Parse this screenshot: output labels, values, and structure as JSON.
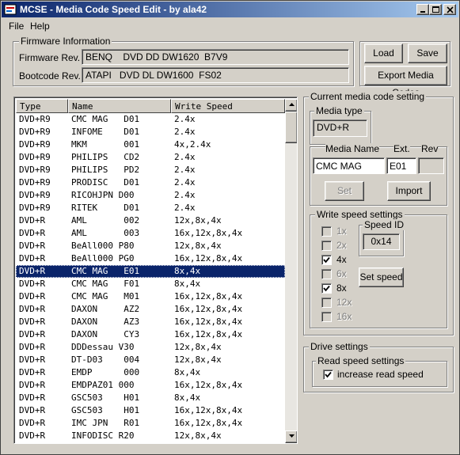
{
  "window": {
    "title": "MCSE - Media Code Speed Edit - by ala42"
  },
  "menu": {
    "file": "File",
    "help": "Help"
  },
  "firmware": {
    "group_label": "Firmware Information",
    "fw_label": "Firmware Rev.",
    "fw_value": "BENQ    DVD DD DW1620  B7V9",
    "boot_label": "Bootcode Rev.",
    "boot_value": "ATAPI   DVD DL DW1600  FS02"
  },
  "buttons": {
    "load": "Load",
    "save": "Save",
    "export": "Export Media Codes",
    "set": "Set",
    "import": "Import",
    "set_speed": "Set speed"
  },
  "list": {
    "headers": [
      "Type",
      "Name",
      "Write Speed"
    ],
    "rows": [
      {
        "type": "DVD+R9",
        "name": "CMC MAG   D01",
        "speed": "2.4x"
      },
      {
        "type": "DVD+R9",
        "name": "INFOME    D01",
        "speed": "2.4x"
      },
      {
        "type": "DVD+R9",
        "name": "MKM       001",
        "speed": "4x,2.4x"
      },
      {
        "type": "DVD+R9",
        "name": "PHILIPS   CD2",
        "speed": "2.4x"
      },
      {
        "type": "DVD+R9",
        "name": "PHILIPS   PD2",
        "speed": "2.4x"
      },
      {
        "type": "DVD+R9",
        "name": "PRODISC   D01",
        "speed": "2.4x"
      },
      {
        "type": "DVD+R9",
        "name": "RICOHJPN D00",
        "speed": "2.4x"
      },
      {
        "type": "DVD+R9",
        "name": "RITEK     D01",
        "speed": "2.4x"
      },
      {
        "type": "DVD+R",
        "name": "AML       002",
        "speed": "12x,8x,4x"
      },
      {
        "type": "DVD+R",
        "name": "AML       003",
        "speed": "16x,12x,8x,4x"
      },
      {
        "type": "DVD+R",
        "name": "BeAll000 P80",
        "speed": "12x,8x,4x"
      },
      {
        "type": "DVD+R",
        "name": "BeAll000 PG0",
        "speed": "16x,12x,8x,4x"
      },
      {
        "type": "DVD+R",
        "name": "CMC MAG   E01",
        "speed": "8x,4x",
        "selected": true
      },
      {
        "type": "DVD+R",
        "name": "CMC MAG   F01",
        "speed": "8x,4x"
      },
      {
        "type": "DVD+R",
        "name": "CMC MAG   M01",
        "speed": "16x,12x,8x,4x"
      },
      {
        "type": "DVD+R",
        "name": "DAXON     AZ2",
        "speed": "16x,12x,8x,4x"
      },
      {
        "type": "DVD+R",
        "name": "DAXON     AZ3",
        "speed": "16x,12x,8x,4x"
      },
      {
        "type": "DVD+R",
        "name": "DAXON     CY3",
        "speed": "16x,12x,8x,4x"
      },
      {
        "type": "DVD+R",
        "name": "DDDessau V30",
        "speed": "12x,8x,4x"
      },
      {
        "type": "DVD+R",
        "name": "DT-D03    004",
        "speed": "12x,8x,4x"
      },
      {
        "type": "DVD+R",
        "name": "EMDP      000",
        "speed": "8x,4x"
      },
      {
        "type": "DVD+R",
        "name": "EMDPAZ01 000",
        "speed": "16x,12x,8x,4x"
      },
      {
        "type": "DVD+R",
        "name": "GSC503    H01",
        "speed": "8x,4x"
      },
      {
        "type": "DVD+R",
        "name": "GSC503    H01",
        "speed": "16x,12x,8x,4x"
      },
      {
        "type": "DVD+R",
        "name": "IMC JPN   R01",
        "speed": "16x,12x,8x,4x"
      },
      {
        "type": "DVD+R",
        "name": "INFODISC R20",
        "speed": "12x,8x,4x"
      }
    ]
  },
  "current": {
    "group_label": "Current media code setting",
    "media_type_label": "Media type",
    "media_type_value": "DVD+R",
    "media_name_label": "Media Name",
    "ext_label": "Ext.",
    "rev_label": "Rev",
    "media_name_value": "CMC MAG",
    "ext_value": "E01",
    "rev_value": ""
  },
  "write_speed": {
    "group_label": "Write speed settings",
    "speeds": [
      {
        "label": "1x",
        "checked": false,
        "enabled": false
      },
      {
        "label": "2x",
        "checked": false,
        "enabled": false
      },
      {
        "label": "4x",
        "checked": true,
        "enabled": true
      },
      {
        "label": "6x",
        "checked": false,
        "enabled": false
      },
      {
        "label": "8x",
        "checked": true,
        "enabled": true
      },
      {
        "label": "12x",
        "checked": false,
        "enabled": false
      },
      {
        "label": "16x",
        "checked": false,
        "enabled": false
      }
    ],
    "speed_id_label": "Speed ID",
    "speed_id_value": "0x14"
  },
  "drive": {
    "group_label": "Drive settings",
    "read_group_label": "Read speed settings",
    "increase_label": "increase read speed",
    "increase_checked": true
  }
}
